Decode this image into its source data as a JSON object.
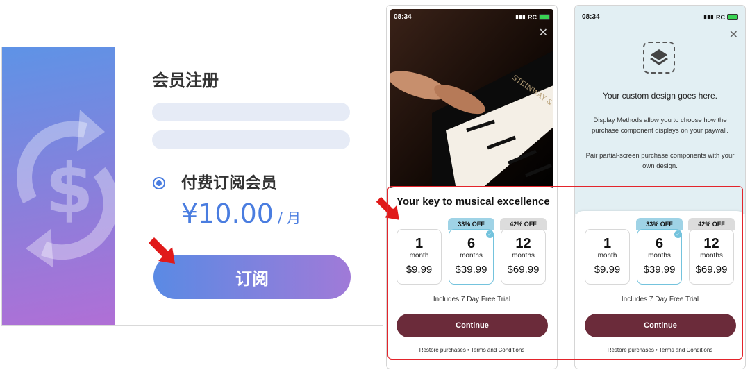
{
  "left_card": {
    "title": "会员注册",
    "plan_name": "付费订阅会员",
    "price_amount": "¥10.00",
    "price_unit": "/ 月",
    "subscribe_label": "订阅",
    "accent_color": "#4a7de0"
  },
  "phone1": {
    "status_time": "08:34",
    "status_carrier": "RC",
    "sheet_title": "Your key to musical excellence",
    "options": [
      {
        "num": "1",
        "period": "month",
        "price": "$9.99"
      },
      {
        "num": "6",
        "period": "months",
        "price": "$39.99",
        "badge": "33% OFF"
      },
      {
        "num": "12",
        "period": "months",
        "price": "$69.99",
        "badge": "42% OFF"
      }
    ],
    "trial_text": "Includes 7 Day Free Trial",
    "continue_label": "Continue",
    "footer": "Restore purchases • Terms and Conditions",
    "button_color": "#6b2b3a"
  },
  "phone2": {
    "status_time": "08:34",
    "status_carrier": "RC",
    "custom_title": "Your custom design goes here.",
    "custom_desc1": "Display Methods allow you to choose how the purchase component displays on your paywall.",
    "custom_desc2": "Pair partial-screen purchase components with your own design.",
    "options": [
      {
        "num": "1",
        "period": "month",
        "price": "$9.99"
      },
      {
        "num": "6",
        "period": "months",
        "price": "$39.99",
        "badge": "33% OFF"
      },
      {
        "num": "12",
        "period": "months",
        "price": "$69.99",
        "badge": "42% OFF"
      }
    ],
    "trial_text": "Includes 7 Day Free Trial",
    "continue_label": "Continue",
    "footer": "Restore purchases • Terms and Conditions"
  }
}
